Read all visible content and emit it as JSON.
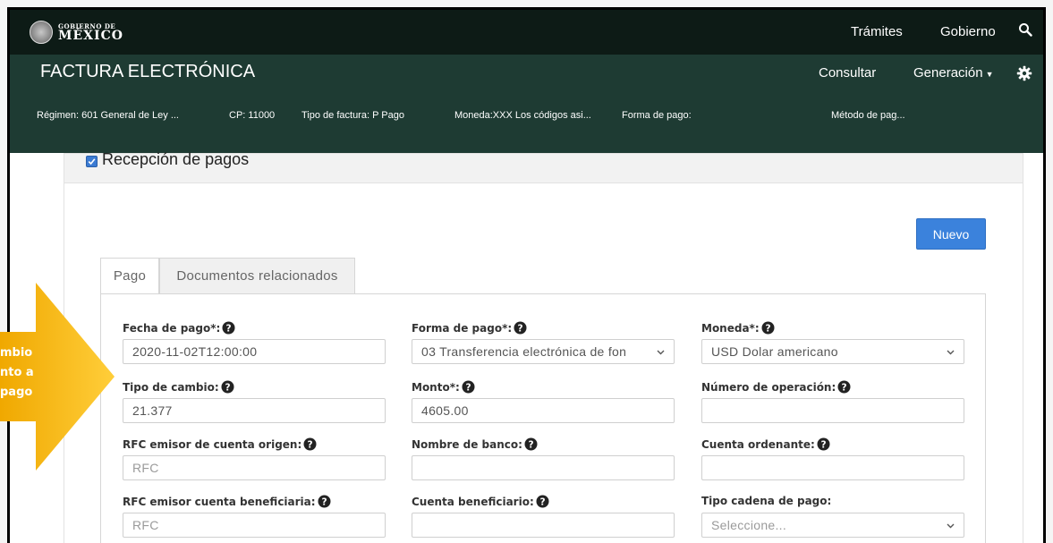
{
  "topbar": {
    "logo_small": "GOBIERNO DE",
    "logo_big": "MÉXICO",
    "nav": [
      "Trámites",
      "Gobierno"
    ],
    "bg": "#0d1b16"
  },
  "appbar": {
    "title": "FACTURA ELECTRÓNICA",
    "nav_consultar": "Consultar",
    "nav_generacion": "Generación",
    "bg": "#1e3b33",
    "meta": {
      "regimen_label": "Régimen:",
      "regimen_value": "601 General de Ley ...",
      "cp_label": "CP:",
      "cp_value": "11000",
      "tipo_label": "Tipo de factura:",
      "tipo_value": "P Pago",
      "moneda": "Moneda:XXX Los códigos asi...",
      "forma": "Forma de pago:",
      "metodo": "Método de pag..."
    }
  },
  "panel": {
    "title": "Recepción de pagos",
    "nuevo_label": "Nuevo",
    "tabs": [
      "Pago",
      "Documentos relacionados"
    ]
  },
  "form": {
    "fecha": {
      "label": "Fecha de pago*:",
      "value": "2020-11-02T12:00:00"
    },
    "forma": {
      "label": "Forma de pago*:",
      "value": "03 Transferencia electrónica de fon"
    },
    "moneda": {
      "label": "Moneda*:",
      "value": "USD Dolar americano"
    },
    "tipo_cambio": {
      "label": "Tipo de cambio:",
      "value": "21.377"
    },
    "monto": {
      "label": "Monto*:",
      "value": "4605.00"
    },
    "num_operacion": {
      "label": "Número de operación:",
      "value": ""
    },
    "rfc_origen": {
      "label": "RFC emisor de cuenta origen:",
      "placeholder": "RFC"
    },
    "banco": {
      "label": "Nombre de banco:",
      "value": ""
    },
    "cuenta_ordenante": {
      "label": "Cuenta ordenante:",
      "value": ""
    },
    "rfc_beneficiaria": {
      "label": "RFC emisor cuenta beneficiaria:",
      "placeholder": "RFC"
    },
    "cuenta_beneficiario": {
      "label": "Cuenta beneficiario:",
      "value": ""
    },
    "tipo_cadena": {
      "label": "Tipo cadena de pago:",
      "value": "Seleccione..."
    }
  },
  "callout": {
    "lines": [
      "mbio",
      "nto a",
      "pago"
    ],
    "color": "#f5b800"
  }
}
